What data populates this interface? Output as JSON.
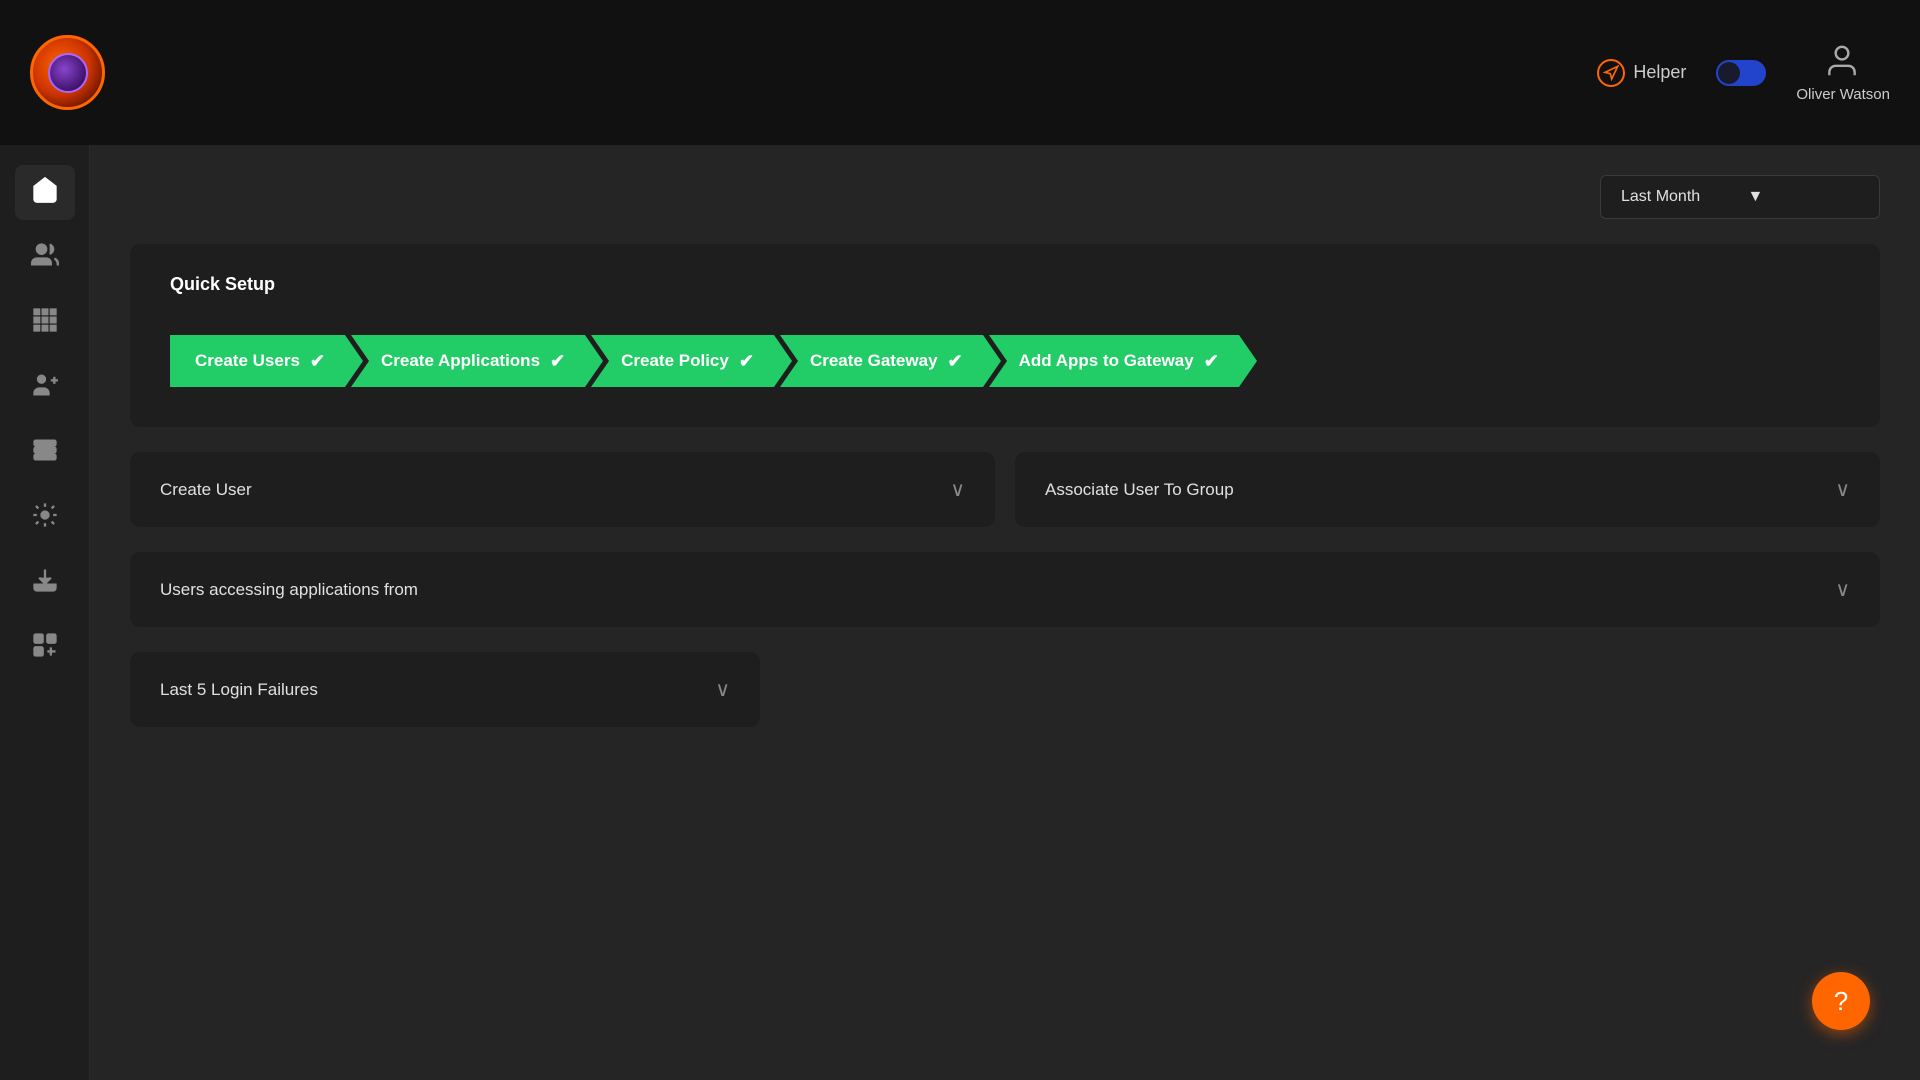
{
  "topbar": {
    "helper_label": "Helper",
    "user_name": "Oliver Watson",
    "dark_mode_toggle_label": "Toggle Dark Mode"
  },
  "filter": {
    "date_label": "Last Month"
  },
  "quick_setup": {
    "title": "Quick Setup",
    "steps": [
      {
        "id": "create-users",
        "label": "Create Users",
        "checked": true
      },
      {
        "id": "create-applications",
        "label": "Create Applications",
        "checked": true
      },
      {
        "id": "create-policy",
        "label": "Create Policy",
        "checked": true
      },
      {
        "id": "create-gateway",
        "label": "Create Gateway",
        "checked": true
      },
      {
        "id": "add-apps-to-gateway",
        "label": "Add Apps to Gateway",
        "checked": true
      }
    ]
  },
  "sidebar": {
    "items": [
      {
        "id": "home",
        "icon": "home",
        "active": true
      },
      {
        "id": "users",
        "icon": "users",
        "active": false
      },
      {
        "id": "grid",
        "icon": "grid",
        "active": false
      },
      {
        "id": "user-connections",
        "icon": "user-connections",
        "active": false
      },
      {
        "id": "list",
        "icon": "list",
        "active": false
      },
      {
        "id": "settings-list",
        "icon": "settings-list",
        "active": false
      },
      {
        "id": "download",
        "icon": "download",
        "active": false
      },
      {
        "id": "add-grid",
        "icon": "add-grid",
        "active": false
      }
    ]
  },
  "panels": {
    "create_user": {
      "title": "Create User",
      "expanded": false
    },
    "associate_user": {
      "title": "Associate User To Group",
      "expanded": false
    },
    "users_accessing": {
      "title": "Users accessing applications from",
      "expanded": false
    },
    "login_failures": {
      "title": "Last 5 Login Failures",
      "expanded": false
    }
  },
  "help_fab": {
    "label": "?"
  }
}
